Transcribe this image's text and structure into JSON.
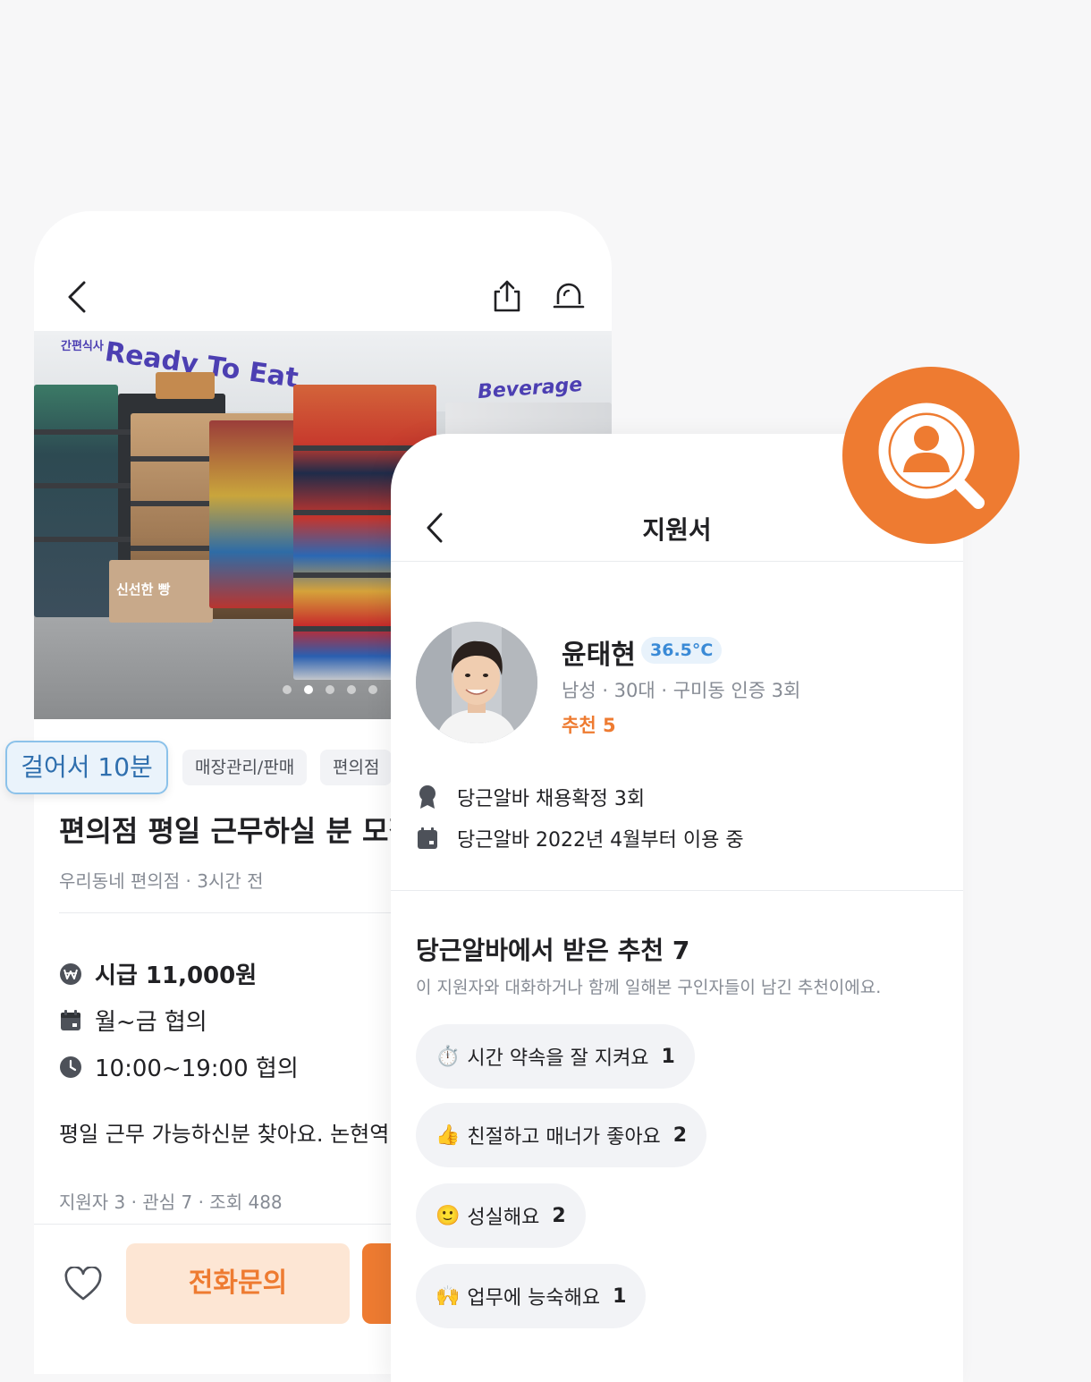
{
  "colors": {
    "accent": "#ee7b31",
    "temperature": "#3a8ad6",
    "walk_tag": "#2f6fae"
  },
  "job_post": {
    "photo": {
      "sign_main": "Ready To Eat",
      "sign_small": "간편식사",
      "sign_right": "Beverage",
      "bakery_label": "신선한 빵",
      "slide_count": 5,
      "active_slide": 2
    },
    "walk_tag": "걸어서 10분",
    "tags": [
      "매장관리/판매",
      "편의점"
    ],
    "title": "편의점 평일 근무하실 분 모집",
    "subtitle": "우리동네 편의점 · 3시간 전",
    "wage": "시급 11,000원",
    "days": "월~금 협의",
    "hours": "10:00~19:00 협의",
    "body": "평일 근무 가능하신분 찾아요. 논현역",
    "stats": "지원자 3 · 관심 7 · 조회 488",
    "call_button": "전화문의"
  },
  "application": {
    "title": "지원서",
    "name": "윤태현",
    "temperature": "36.5°C",
    "meta": "남성 · 30대 · 구미동 인증 3회",
    "recommend": "추천 5",
    "hire_count": "당근알바 채용확정 3회",
    "since": "당근알바 2022년 4월부터 이용 중",
    "section_title": "당근알바에서 받은 추천 7",
    "section_sub": "이 지원자와 대화하거나 함께 일해본 구인자들이 남긴 추천이에요.",
    "recommendations": [
      {
        "emoji": "⏱️",
        "label": "시간 약속을 잘 지켜요",
        "count": "1"
      },
      {
        "emoji": "👍",
        "label": "친절하고 매너가 좋아요",
        "count": "2"
      },
      {
        "emoji": "🙂",
        "label": "성실해요",
        "count": "2"
      },
      {
        "emoji": "🙌",
        "label": "업무에 능숙해요",
        "count": "1"
      }
    ]
  }
}
